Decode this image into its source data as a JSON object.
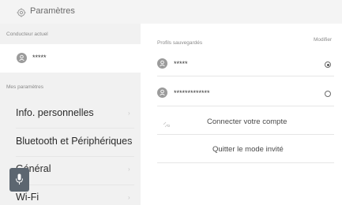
{
  "header": {
    "title": "Paramètres",
    "icon": "gear-icon"
  },
  "current_driver": {
    "section_label": "Conducteur actuel",
    "name": "*****",
    "icon": "user-icon"
  },
  "my_settings": {
    "section_label": "Mes paramètres",
    "items": [
      {
        "label": "Info. personnelles"
      },
      {
        "label": "Bluetooth et Périphériques"
      },
      {
        "label": "Général"
      },
      {
        "label": "Wi-Fi"
      }
    ]
  },
  "saved_profiles": {
    "section_label": "Profils sauvegardés",
    "edit_label": "Modifier",
    "profiles": [
      {
        "name": "*****",
        "selected": true
      },
      {
        "name": "*************",
        "selected": false
      }
    ]
  },
  "actions": {
    "connect_label": "Connecter votre compte",
    "quit_guest_label": "Quitter le mode invité"
  },
  "voice": {
    "icon": "microphone-icon"
  }
}
